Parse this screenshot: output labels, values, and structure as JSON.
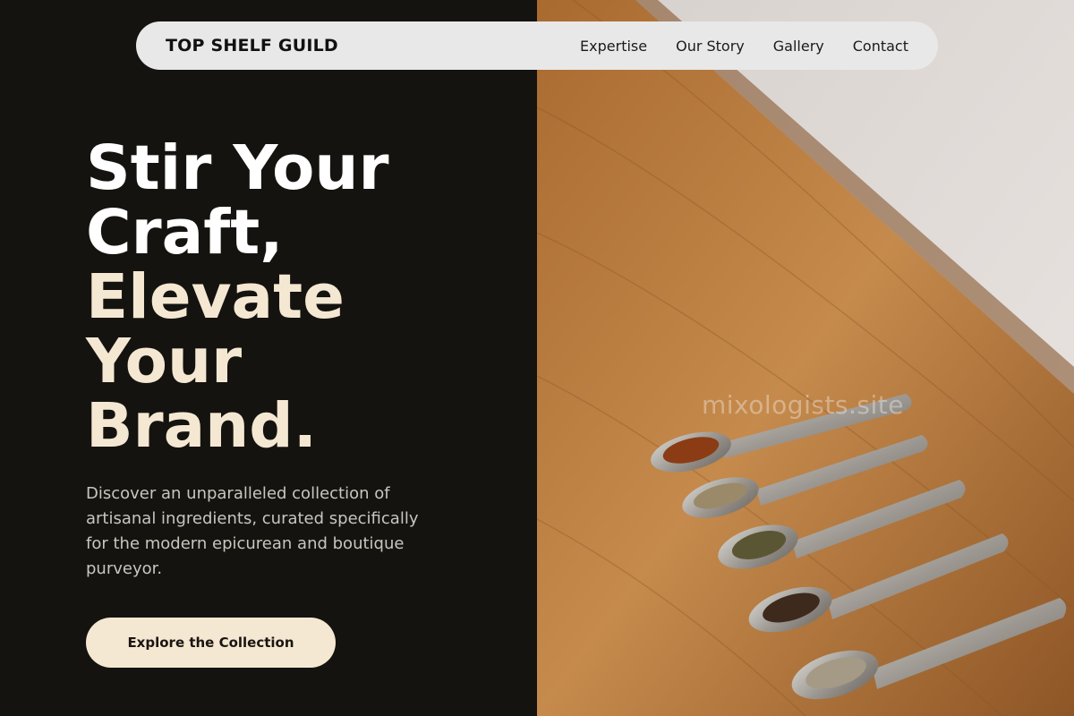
{
  "nav": {
    "brand": "TOP SHELF GUILD",
    "links": [
      {
        "label": "Expertise"
      },
      {
        "label": "Our Story"
      },
      {
        "label": "Gallery"
      },
      {
        "label": "Contact"
      }
    ]
  },
  "hero": {
    "headline_line1": "Stir Your",
    "headline_line2": "Craft,",
    "headline_line3": "Elevate",
    "headline_line4": "Your",
    "headline_line5": "Brand.",
    "subtext": "Discover an unparalleled collection of artisanal ingredients, curated specifically for the modern epicurean and boutique purveyor.",
    "cta_label": "Explore the Collection"
  },
  "image": {
    "watermark": "mixologists.site"
  },
  "colors": {
    "background": "#15130f",
    "accent": "#f5e8d3",
    "navbar": "#e9e8e8",
    "wood": "#b87a3c"
  }
}
